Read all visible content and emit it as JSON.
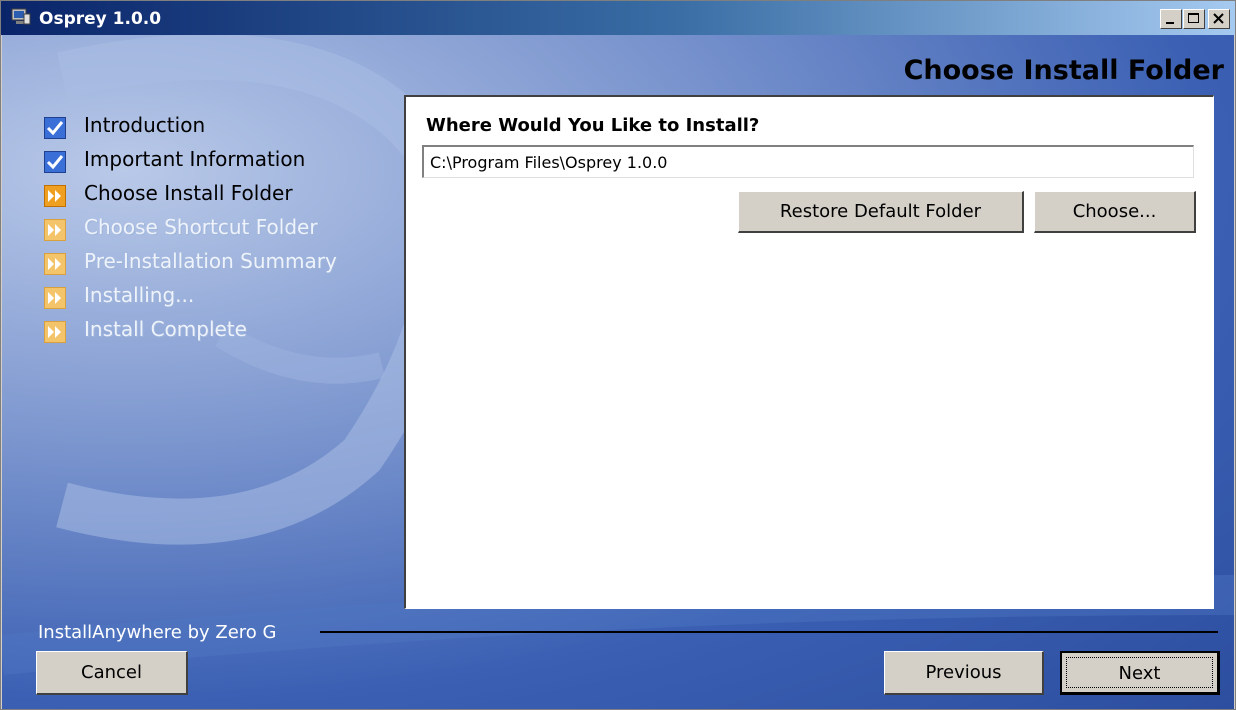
{
  "window": {
    "title": "Osprey 1.0.0",
    "controls": [
      "minimize-icon",
      "maximize-icon",
      "close-icon"
    ]
  },
  "page": {
    "heading": "Choose Install Folder"
  },
  "steps": [
    {
      "label": "Introduction",
      "state": "done",
      "icon": "checkmark-icon"
    },
    {
      "label": "Important Information",
      "state": "done",
      "icon": "checkmark-icon"
    },
    {
      "label": "Choose Install Folder",
      "state": "current",
      "icon": "double-arrow-icon"
    },
    {
      "label": "Choose Shortcut Folder",
      "state": "pending",
      "icon": "double-arrow-icon"
    },
    {
      "label": "Pre-Installation Summary",
      "state": "pending",
      "icon": "double-arrow-icon"
    },
    {
      "label": "Installing...",
      "state": "pending",
      "icon": "double-arrow-icon"
    },
    {
      "label": "Install Complete",
      "state": "pending",
      "icon": "double-arrow-icon"
    }
  ],
  "install": {
    "prompt": "Where Would You Like to Install?",
    "path_value": "C:\\Program Files\\Osprey 1.0.0",
    "restore_label": "Restore Default Folder",
    "choose_label": "Choose..."
  },
  "footer": {
    "brand": "InstallAnywhere by Zero G",
    "cancel_label": "Cancel",
    "previous_label": "Previous",
    "next_label": "Next"
  },
  "colors": {
    "title_gradient_start": "#0a246a",
    "title_gradient_end": "#a6caf0",
    "background_blue": "#3a5fb3",
    "check_blue": "#3b6fd8",
    "arrow_orange": "#f0a020"
  }
}
